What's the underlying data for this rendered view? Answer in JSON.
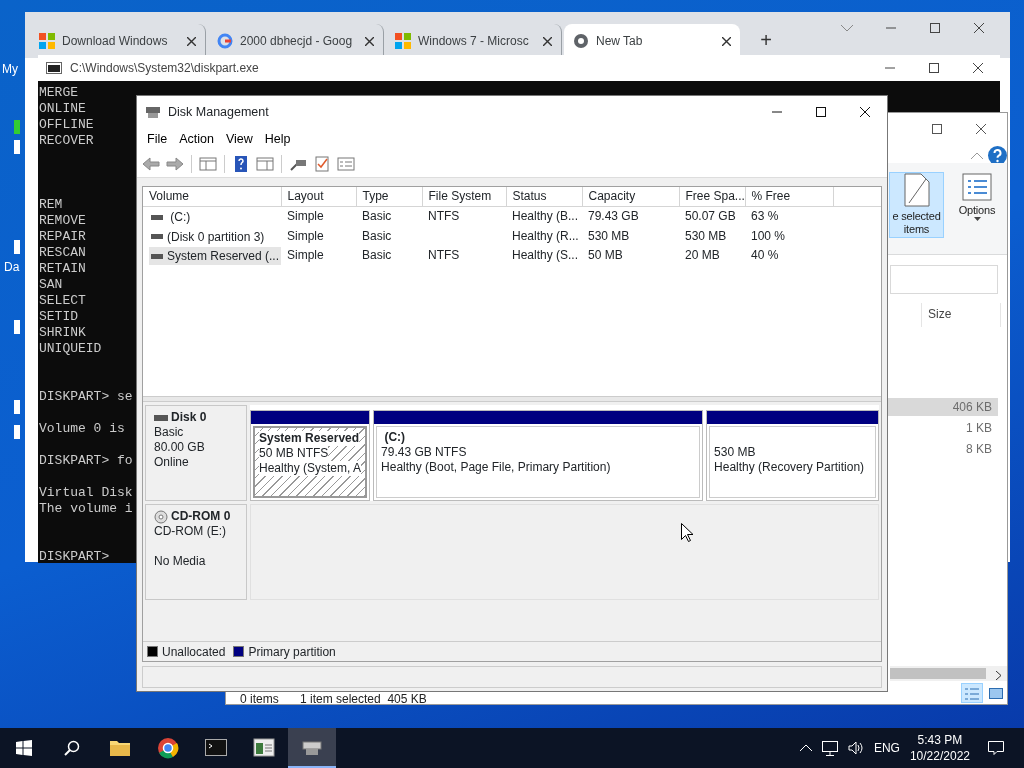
{
  "desktop": {
    "icon_labels": [
      "My",
      "Da"
    ]
  },
  "browser": {
    "tabs": [
      {
        "title": "Download Windows",
        "kind": "windows",
        "selected": false
      },
      {
        "title": "2000 dbhecjd - Goog",
        "kind": "google",
        "selected": false
      },
      {
        "title": "Windows 7 - Microsc",
        "kind": "windows",
        "selected": false
      },
      {
        "title": "New Tab",
        "kind": "chrome",
        "selected": true
      }
    ],
    "new_tab": "+"
  },
  "console": {
    "title": "C:\\Windows\\System32\\diskpart.exe",
    "blocks": [
      {
        "lines": [
          "MERGE",
          "ONLINE",
          "OFFLINE",
          "RECOVER"
        ]
      },
      {
        "lines": [
          "REM",
          "REMOVE",
          "REPAIR",
          "RESCAN",
          "RETAIN",
          "SAN",
          "SELECT",
          "SETID",
          "SHRINK",
          "UNIQUEID"
        ]
      },
      {
        "lines": [
          "DISKPART> se"
        ]
      },
      {
        "lines": [
          "Volume 0 is"
        ]
      },
      {
        "lines": [
          "DISKPART> fo"
        ]
      },
      {
        "lines": [
          "Virtual Disk",
          "The volume i"
        ]
      },
      {
        "lines": [
          "DISKPART>"
        ]
      }
    ]
  },
  "explorer": {
    "ribbon_buttons": [
      {
        "kind": "page",
        "label": "e selected items",
        "selected": true
      },
      {
        "kind": "options",
        "label": "Options",
        "selected": false
      }
    ],
    "column": "Size",
    "rows": [
      {
        "size": "406 KB",
        "selected": true
      },
      {
        "size": "1 KB",
        "selected": false
      },
      {
        "size": "8 KB",
        "selected": false
      }
    ],
    "status": [
      "0 items",
      "1 item selected  405 KB"
    ]
  },
  "disk_management": {
    "title": "Disk Management",
    "menu": [
      "File",
      "Action",
      "View",
      "Help"
    ],
    "volume_table": {
      "columns": [
        "Volume",
        "Layout",
        "Type",
        "File System",
        "Status",
        "Capacity",
        "Free Spa...",
        "% Free"
      ],
      "rows": [
        {
          "selected": false,
          "cells": [
            " (C:)",
            "Simple",
            "Basic",
            "NTFS",
            "Healthy (B...",
            "79.43 GB",
            "50.07 GB",
            "63 %"
          ]
        },
        {
          "selected": false,
          "cells": [
            "(Disk 0 partition 3)",
            "Simple",
            "Basic",
            "",
            "Healthy (R...",
            "530 MB",
            "530 MB",
            "100 %"
          ]
        },
        {
          "selected": true,
          "cells": [
            "System Reserved (...",
            "Simple",
            "Basic",
            "NTFS",
            "Healthy (S...",
            "50 MB",
            "20 MB",
            "40 %"
          ]
        }
      ]
    },
    "disks": [
      {
        "kind": "disk",
        "name": "Disk 0",
        "lines": [
          "Basic",
          "80.00 GB",
          "Online"
        ],
        "partitions": [
          {
            "name": "System Reserved",
            "size": "50 MB NTFS",
            "status": "Healthy (System, A",
            "selected": true
          },
          {
            "name": " (C:)",
            "size": "79.43 GB NTFS",
            "status": "Healthy (Boot, Page File, Primary Partition)",
            "selected": false
          },
          {
            "size": "530 MB",
            "status": "Healthy (Recovery Partition)",
            "selected": false
          }
        ]
      },
      {
        "kind": "cdrom",
        "name": "CD-ROM 0",
        "lines": [
          "CD-ROM (E:)"
        ],
        "status": "No Media"
      }
    ],
    "legend": [
      {
        "label": "Unallocated",
        "color": "#000000"
      },
      {
        "label": "Primary partition",
        "color": "#000080"
      }
    ]
  },
  "taskbar": {
    "apps": [
      {
        "kind": "folder",
        "active": false
      },
      {
        "kind": "chrome",
        "active": false
      },
      {
        "kind": "console",
        "active": false
      },
      {
        "kind": "window",
        "active": false
      },
      {
        "kind": "disk",
        "active": true
      }
    ],
    "tray": {
      "language": "ENG",
      "time": "5:43 PM",
      "date": "10/22/2022"
    }
  }
}
